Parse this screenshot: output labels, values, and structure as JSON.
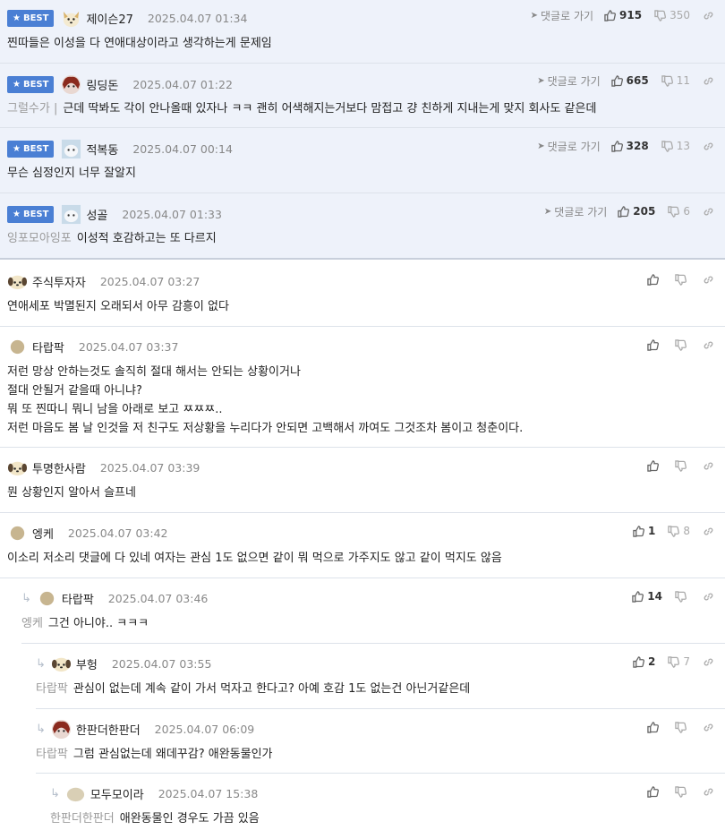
{
  "ui": {
    "best_label": "BEST",
    "goto_label": "댓글로 가기"
  },
  "comments": [
    {
      "nick": "제이슨27",
      "date": "2025.04.07 01:34",
      "up": "915",
      "down": "350",
      "tag": "",
      "text": "찐따들은 이성을 다 연애대상이라고 생각하는게 문제임"
    },
    {
      "nick": "링딩돈",
      "date": "2025.04.07 01:22",
      "up": "665",
      "down": "11",
      "tag": "그럴수가 |",
      "text": "근데 딱봐도 각이 안나올때 있자나 ㅋㅋ 괜히 어색해지는거보다 맘접고 걍 친하게 지내는게 맞지 회사도 같은데"
    },
    {
      "nick": "적복동",
      "date": "2025.04.07 00:14",
      "up": "328",
      "down": "13",
      "tag": "",
      "text": "무슨 심정인지 너무 잘알지"
    },
    {
      "nick": "성골",
      "date": "2025.04.07 01:33",
      "up": "205",
      "down": "6",
      "tag": "잉포모아잉포",
      "text": "이성적 호감하고는 또 다르지"
    },
    {
      "nick": "주식투자자",
      "date": "2025.04.07 03:27",
      "up": "",
      "down": "",
      "tag": "",
      "text": "연애세포 박멸된지 오래되서 아무 감흥이 없다"
    },
    {
      "nick": "타랍팍",
      "date": "2025.04.07 03:37",
      "up": "",
      "down": "",
      "tag": "",
      "lines": [
        "저런 망상 안하는것도 솔직히 절대 해서는 안되는 상황이거나",
        "절대 안될거 같을때 아니냐?",
        "뭐 또 찐따니 뭐니 남을 아래로 보고 ㅉㅉㅉ..",
        "저런 마음도 봄 날 인것을 저 친구도 저상황을 누리다가 안되면 고백해서 까여도 그것조차 봄이고 청춘이다."
      ]
    },
    {
      "nick": "투명한사람",
      "date": "2025.04.07 03:39",
      "up": "",
      "down": "",
      "tag": "",
      "text": "뭔 상황인지 알아서 슬프네"
    },
    {
      "nick": "엥케",
      "date": "2025.04.07 03:42",
      "up": "1",
      "down": "8",
      "tag": "",
      "text": "이소리 저소리 댓글에 다 있네 여자는 관심 1도 없으면 같이 뭐 먹으로 가주지도 않고 같이 먹지도 않음"
    },
    {
      "nick": "타랍팍",
      "date": "2025.04.07 03:46",
      "up": "14",
      "down": "",
      "tag": "엥케",
      "text": "그건 아니야.. ㅋㅋㅋ"
    },
    {
      "nick": "부헝",
      "date": "2025.04.07 03:55",
      "up": "2",
      "down": "7",
      "tag": "타랍팍",
      "text": "관심이 없는데 계속 같이 가서 먹자고 한다고? 아예 호감 1도 없는건 아닌거같은데"
    },
    {
      "nick": "한판더한판더",
      "date": "2025.04.07 06:09",
      "up": "",
      "down": "",
      "tag": "타랍팍",
      "text": "그럼 관심없는데 왜데꾸감? 애완동물인가"
    },
    {
      "nick": "모두모이라",
      "date": "2025.04.07 15:38",
      "up": "",
      "down": "",
      "tag": "한판더한판더",
      "text": "애완동물인 경우도 가끔 있음"
    }
  ]
}
